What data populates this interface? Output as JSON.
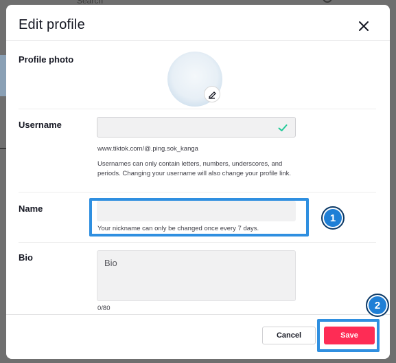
{
  "background": {
    "search_label": "Search"
  },
  "modal": {
    "title": "Edit profile",
    "close_icon": "close-icon"
  },
  "profile_photo": {
    "label": "Profile photo",
    "edit_icon": "pencil-icon"
  },
  "username": {
    "label": "Username",
    "value": "",
    "valid_icon": "checkmark-icon",
    "valid_color": "#20c997",
    "url": "www.tiktok.com/@.ping.sok_kanga",
    "help": "Usernames can only contain letters, numbers, underscores, and periods. Changing your username will also change your profile link."
  },
  "name": {
    "label": "Name",
    "value": "",
    "help": "Your nickname can only be changed once every 7 days."
  },
  "bio": {
    "label": "Bio",
    "placeholder": "Bio",
    "count": "0/80"
  },
  "footer": {
    "cancel_label": "Cancel",
    "save_label": "Save"
  },
  "annotations": {
    "step_1": "1",
    "step_2": "2",
    "highlight_color": "#2f8fe0"
  },
  "colors": {
    "accent": "#fe2c55",
    "text": "#161823"
  }
}
